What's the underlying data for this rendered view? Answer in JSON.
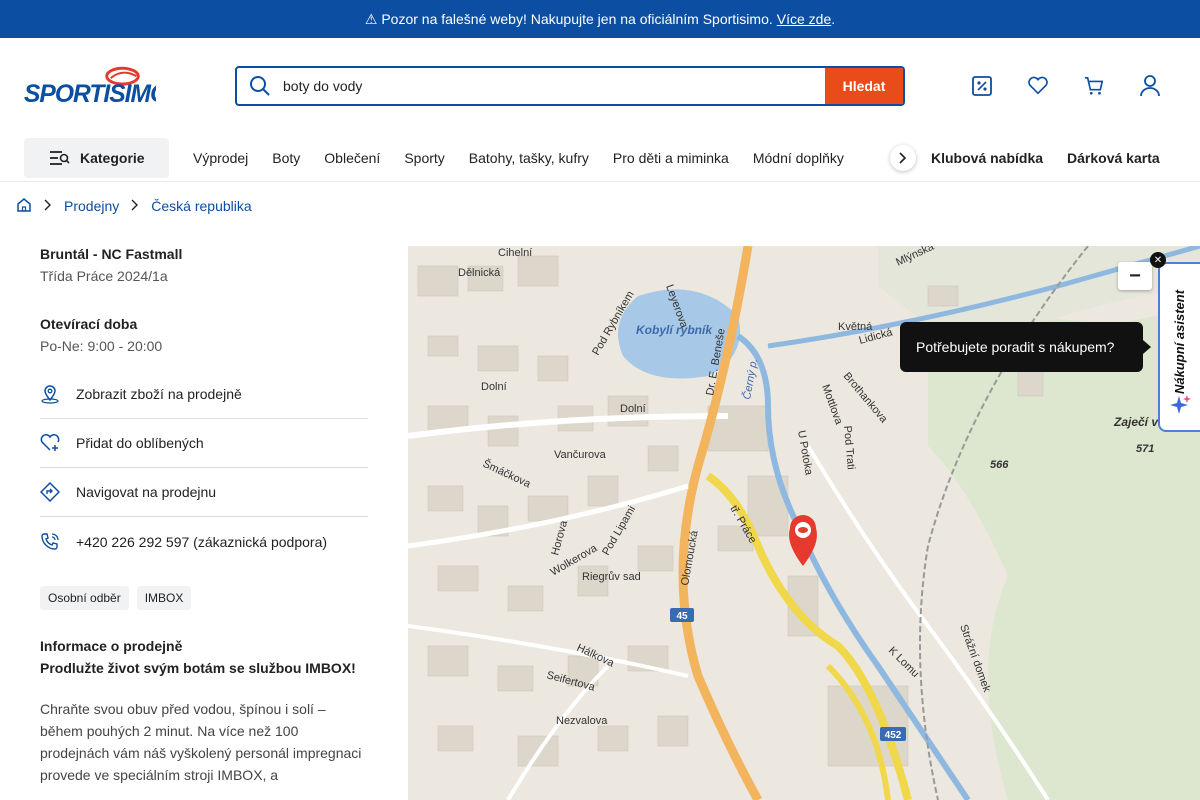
{
  "banner": {
    "text": "⚠ Pozor na falešné weby! Nakupujte jen na oficiálním Sportisimo.",
    "link": "Více zde",
    "end": "."
  },
  "header": {
    "logo_text": "SPORTISIMO",
    "search_value": "boty do vody",
    "search_button": "Hledat",
    "icons": [
      "discount-icon",
      "heart-icon",
      "cart-icon",
      "user-icon"
    ]
  },
  "nav": {
    "category_button": "Kategorie",
    "items": [
      "Výprodej",
      "Boty",
      "Oblečení",
      "Sporty",
      "Batohy, tašky, kufry",
      "Pro děti a miminka",
      "Módní doplňky"
    ],
    "right_items": [
      "Klubová nabídka",
      "Dárková karta"
    ]
  },
  "breadcrumb": {
    "items": [
      "Prodejny",
      "Česká republika"
    ]
  },
  "store": {
    "name": "Bruntál - NC Fastmall",
    "address": "Třída Práce 2024/1a",
    "hours_heading": "Otevírací doba",
    "hours": "Po-Ne: 9:00 - 20:00",
    "actions": [
      {
        "label": "Zobrazit zboží na prodejně",
        "icon": "map-pin-icon"
      },
      {
        "label": "Přidat do oblíbených",
        "icon": "heart-plus-icon"
      },
      {
        "label": "Navigovat na prodejnu",
        "icon": "directions-icon"
      },
      {
        "label": "+420 226 292 597 (zákaznická podpora)",
        "icon": "phone-icon"
      }
    ],
    "tags": [
      "Osobní odběr",
      "IMBOX"
    ],
    "info_heading": "Informace o prodejně",
    "info_sub": "Prodlužte život svým botám se službou IMBOX!",
    "info_text": "Chraňte svou obuv před vodou, špínou i solí – během pouhých 2 minut. Na více než 100 prodejnách vám náš vyškolený personál impregnaci provede ve speciálním stroji IMBOX, a"
  },
  "map": {
    "zoom_label": "−",
    "assistant_bubble": "Potřebujete poradit s nákupem?",
    "assistant_label": "Nákupní asistent",
    "labels": {
      "pond": "Kobylí rybník",
      "stream": "Černý p.",
      "area": "Zaječí v",
      "street_1": "Cihelní",
      "street_2": "Dělnická",
      "street_3": "Leyerova",
      "street_4": "Dr. E. Beneše",
      "street_5": "Pod Rybníkem",
      "street_6": "Dolní",
      "street_7": "Vančurova",
      "street_8": "Šmáčkova",
      "street_9": "Olomoucká",
      "street_10": "tř. Práce",
      "street_11": "Riegrův sad",
      "street_12": "Pod Lipami",
      "street_13": "U Potoka",
      "street_14": "K Lomu",
      "street_15": "Strážní domek",
      "street_16": "Nezvalova",
      "street_17": "Seifertova",
      "street_18": "Hálkova",
      "street_19": "Mlýnská",
      "street_20": "Lidická",
      "street_21": "Květná",
      "street_22": "Brothankova",
      "street_23": "Mottlova",
      "street_24": "Pod Trati",
      "street_25": "Horova",
      "street_26": "Wolkerova",
      "road_45": "45",
      "road_452": "452",
      "elev_1": "566",
      "elev_2": "571"
    }
  }
}
